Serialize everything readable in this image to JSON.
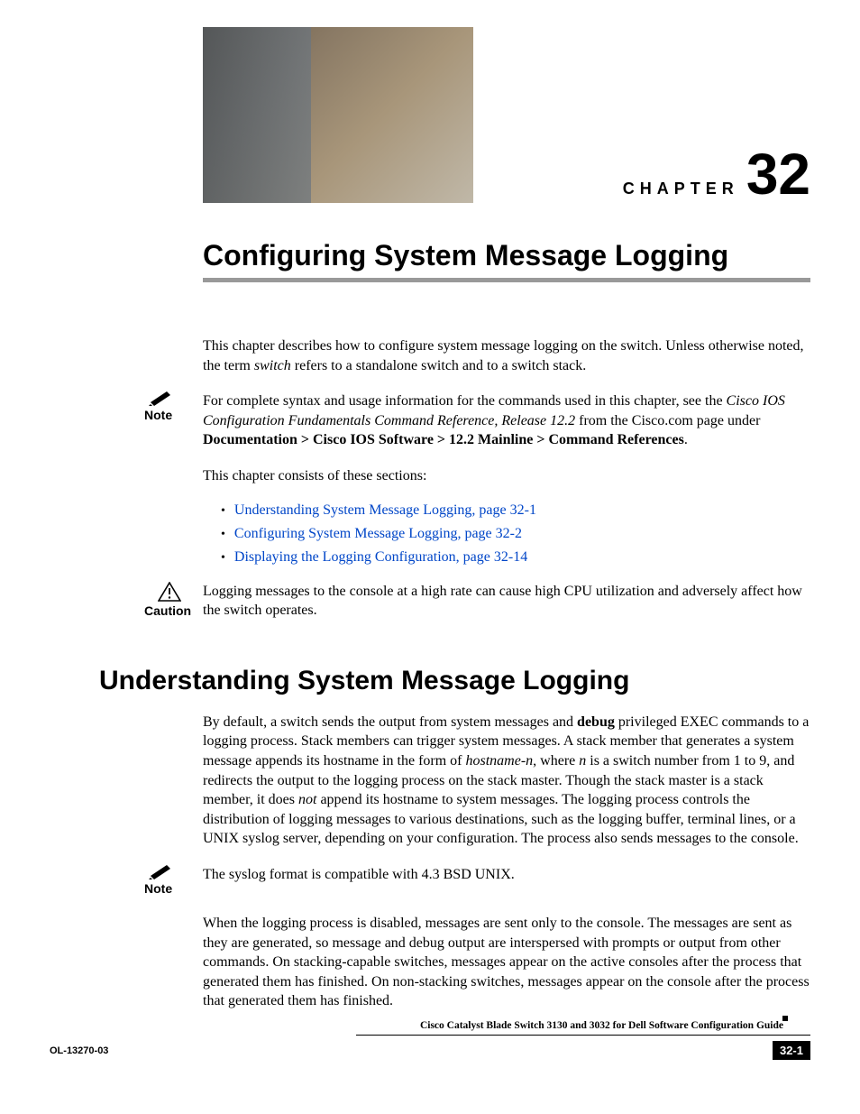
{
  "chapter": {
    "label": "CHAPTER",
    "number": "32",
    "title": "Configuring System Message Logging"
  },
  "intro": {
    "p1_a": "This chapter describes how to configure system message logging on the switch. Unless otherwise noted, the term ",
    "p1_i": "switch",
    "p1_b": " refers to a standalone switch and to a switch stack."
  },
  "note1": {
    "label": "Note",
    "a": "For complete syntax and usage information for the commands used in this chapter, see the ",
    "i1": "Cisco IOS Configuration Fundamentals Command Reference, Release 12.2",
    "b": " from the Cisco.com page under ",
    "bold": "Documentation > Cisco IOS Software > 12.2 Mainline > Command References",
    "c": "."
  },
  "sections_intro": "This chapter consists of these sections:",
  "toc": [
    "Understanding System Message Logging, page 32-1",
    "Configuring System Message Logging, page 32-2",
    "Displaying the Logging Configuration, page 32-14"
  ],
  "caution": {
    "label": "Caution",
    "text": "Logging messages to the console at a high rate can cause high CPU utilization and adversely affect how the switch operates."
  },
  "h1": "Understanding System Message Logging",
  "body": {
    "p1_a": "By default, a switch sends the output from system messages and ",
    "p1_b1": "debug",
    "p1_b": " privileged EXEC commands to a logging process. Stack members can trigger system messages. A stack member that generates a system message appends its hostname in the form of ",
    "p1_i1": "hostname-n",
    "p1_c": ", where ",
    "p1_i2": "n",
    "p1_d": " is a switch number from 1 to 9, and redirects the output to the logging process on the stack master. Though the stack master is a stack member, it does ",
    "p1_i3": "not",
    "p1_e": " append its hostname to system messages. The logging process controls the distribution of logging messages to various destinations, such as the logging buffer, terminal lines, or a UNIX syslog server, depending on your configuration. The process also sends messages to the console."
  },
  "note2": {
    "label": "Note",
    "text": "The syslog format is compatible with 4.3 BSD UNIX."
  },
  "p3": "When the logging process is disabled, messages are sent only to the console. The messages are sent as they are generated, so message and debug output are interspersed with prompts or output from other commands. On stacking-capable switches, messages appear on the active consoles after the process that generated them has finished. On non-stacking switches, messages appear on the console after the process that generated them has finished.",
  "footer": {
    "doc_title": "Cisco Catalyst Blade Switch 3130 and 3032 for Dell Software Configuration Guide",
    "doc_num": "OL-13270-03",
    "page": "32-1"
  }
}
